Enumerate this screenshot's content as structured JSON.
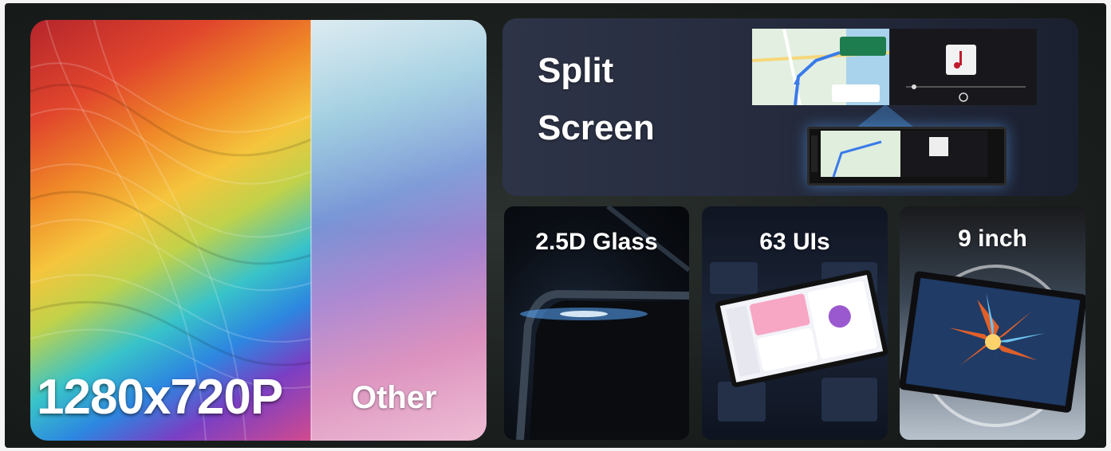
{
  "resolution": {
    "high_label": "1280x720P",
    "other_label": "Other"
  },
  "split_screen": {
    "title": "Split Screen"
  },
  "features": [
    {
      "title": "2.5D Glass"
    },
    {
      "title": "63 UIs"
    },
    {
      "title": "9 inch"
    }
  ],
  "colors": {
    "background": "#1c211f",
    "split_card": "#2a3042",
    "text": "#ffffff"
  }
}
